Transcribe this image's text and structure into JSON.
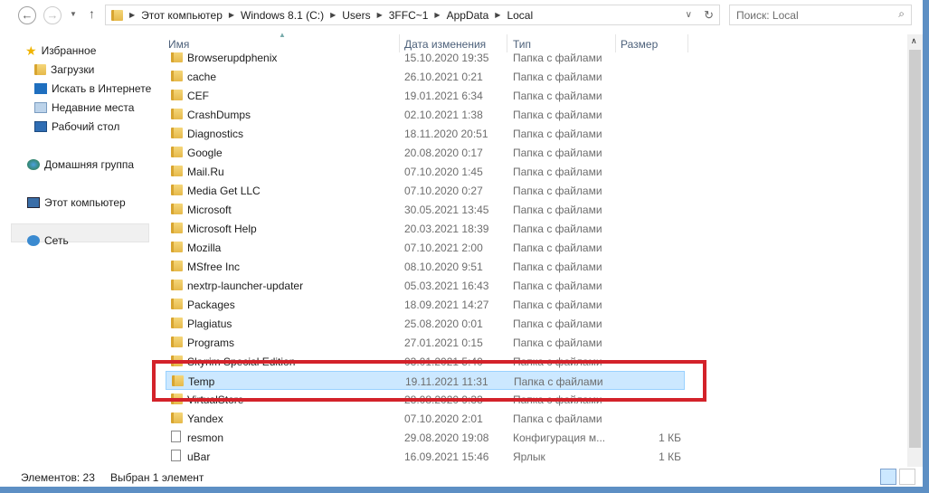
{
  "address": {
    "crumbs": [
      "Этот компьютер",
      "Windows 8.1 (C:)",
      "Users",
      "3FFC~1",
      "AppData",
      "Local"
    ]
  },
  "search": {
    "placeholder": "Поиск: Local"
  },
  "nav": {
    "favorites": "Избранное",
    "items": [
      "Загрузки",
      "Искать в Интернете",
      "Недавние места",
      "Рабочий стол"
    ],
    "homegroup": "Домашняя группа",
    "computer": "Этот компьютер",
    "network": "Сеть"
  },
  "columns": {
    "name": "Имя",
    "date": "Дата изменения",
    "type": "Тип",
    "size": "Размер"
  },
  "files": [
    {
      "name": "Browserupdphenix",
      "date": "15.10.2020 19:35",
      "type": "Папка с файлами",
      "size": "",
      "icon": "folder"
    },
    {
      "name": "cache",
      "date": "26.10.2021 0:21",
      "type": "Папка с файлами",
      "size": "",
      "icon": "folder"
    },
    {
      "name": "CEF",
      "date": "19.01.2021 6:34",
      "type": "Папка с файлами",
      "size": "",
      "icon": "folder"
    },
    {
      "name": "CrashDumps",
      "date": "02.10.2021 1:38",
      "type": "Папка с файлами",
      "size": "",
      "icon": "folder"
    },
    {
      "name": "Diagnostics",
      "date": "18.11.2020 20:51",
      "type": "Папка с файлами",
      "size": "",
      "icon": "folder"
    },
    {
      "name": "Google",
      "date": "20.08.2020 0:17",
      "type": "Папка с файлами",
      "size": "",
      "icon": "folder"
    },
    {
      "name": "Mail.Ru",
      "date": "07.10.2020 1:45",
      "type": "Папка с файлами",
      "size": "",
      "icon": "folder"
    },
    {
      "name": "Media Get LLC",
      "date": "07.10.2020 0:27",
      "type": "Папка с файлами",
      "size": "",
      "icon": "folder"
    },
    {
      "name": "Microsoft",
      "date": "30.05.2021 13:45",
      "type": "Папка с файлами",
      "size": "",
      "icon": "folder"
    },
    {
      "name": "Microsoft Help",
      "date": "20.03.2021 18:39",
      "type": "Папка с файлами",
      "size": "",
      "icon": "folder"
    },
    {
      "name": "Mozilla",
      "date": "07.10.2021 2:00",
      "type": "Папка с файлами",
      "size": "",
      "icon": "folder"
    },
    {
      "name": "MSfree Inc",
      "date": "08.10.2020 9:51",
      "type": "Папка с файлами",
      "size": "",
      "icon": "folder"
    },
    {
      "name": "nextrp-launcher-updater",
      "date": "05.03.2021 16:43",
      "type": "Папка с файлами",
      "size": "",
      "icon": "folder"
    },
    {
      "name": "Packages",
      "date": "18.09.2021 14:27",
      "type": "Папка с файлами",
      "size": "",
      "icon": "folder"
    },
    {
      "name": "Plagiatus",
      "date": "25.08.2020 0:01",
      "type": "Папка с файлами",
      "size": "",
      "icon": "folder"
    },
    {
      "name": "Programs",
      "date": "27.01.2021 0:15",
      "type": "Папка с файлами",
      "size": "",
      "icon": "folder"
    },
    {
      "name": "Skyrim Special Edition",
      "date": "03.01.2021 5:40",
      "type": "Папка с файлами",
      "size": "",
      "icon": "folder"
    },
    {
      "name": "Temp",
      "date": "19.11.2021 11:31",
      "type": "Папка с файлами",
      "size": "",
      "icon": "folder",
      "selected": true
    },
    {
      "name": "VirtualStore",
      "date": "28.08.2020 9:33",
      "type": "Папка с файлами",
      "size": "",
      "icon": "folder"
    },
    {
      "name": "Yandex",
      "date": "07.10.2020 2:01",
      "type": "Папка с файлами",
      "size": "",
      "icon": "folder"
    },
    {
      "name": "resmon",
      "date": "29.08.2020 19:08",
      "type": "Конфигурация м...",
      "size": "1 КБ",
      "icon": "config-file"
    },
    {
      "name": "uBar",
      "date": "16.09.2021 15:46",
      "type": "Ярлык",
      "size": "1 КБ",
      "icon": "shortcut"
    }
  ],
  "status": {
    "count": "Элементов: 23",
    "selection": "Выбран 1 элемент"
  },
  "colors": {
    "highlight": "#d3222a",
    "selection": "#cce8ff",
    "frame": "#5d8fc4"
  }
}
